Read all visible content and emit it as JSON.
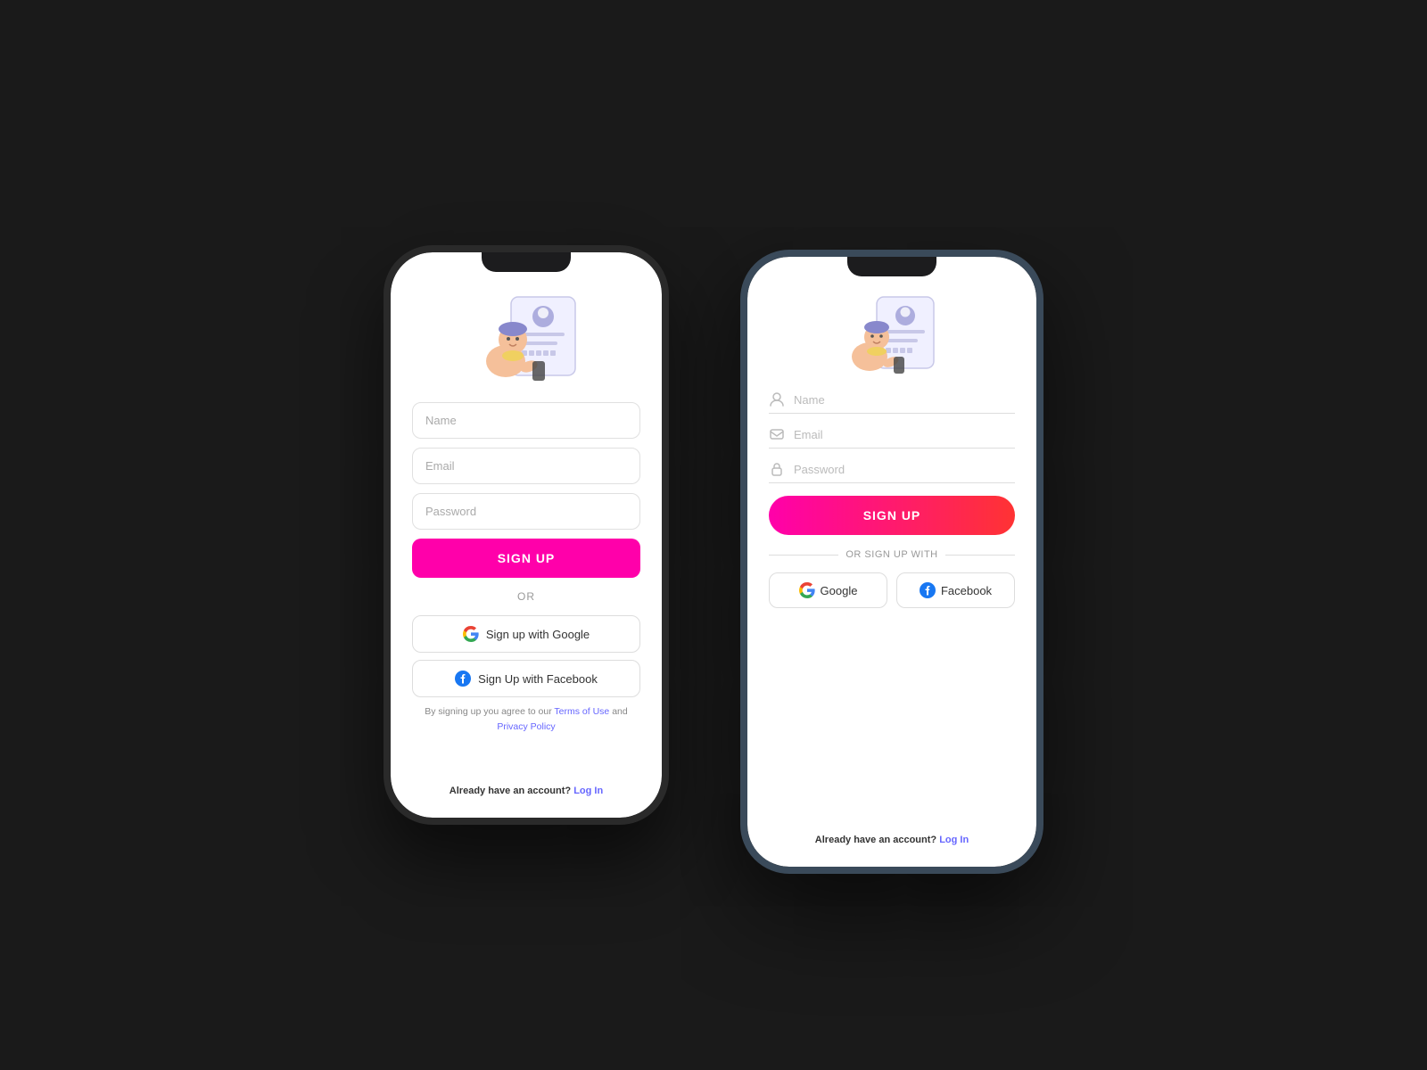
{
  "phone_left": {
    "fields": {
      "name_placeholder": "Name",
      "email_placeholder": "Email",
      "password_placeholder": "Password"
    },
    "signup_button": "SIGN UP",
    "or_label": "OR",
    "google_btn": "Sign up with Google",
    "facebook_btn": "Sign Up with Facebook",
    "terms_prefix": "By signing up you agree to our ",
    "terms_link": "Terms of Use",
    "terms_middle": " and ",
    "privacy_link": "Privacy Policy",
    "login_prefix": "Already have an account? ",
    "login_link": "Log In"
  },
  "phone_right": {
    "fields": {
      "name_placeholder": "Name",
      "email_placeholder": "Email",
      "password_placeholder": "Password"
    },
    "signup_button": "SIGN UP",
    "or_label": "OR SIGN UP WITH",
    "google_btn": "Google",
    "facebook_btn": "Facebook",
    "login_prefix": "Already have an account? ",
    "login_link": "Log In"
  }
}
